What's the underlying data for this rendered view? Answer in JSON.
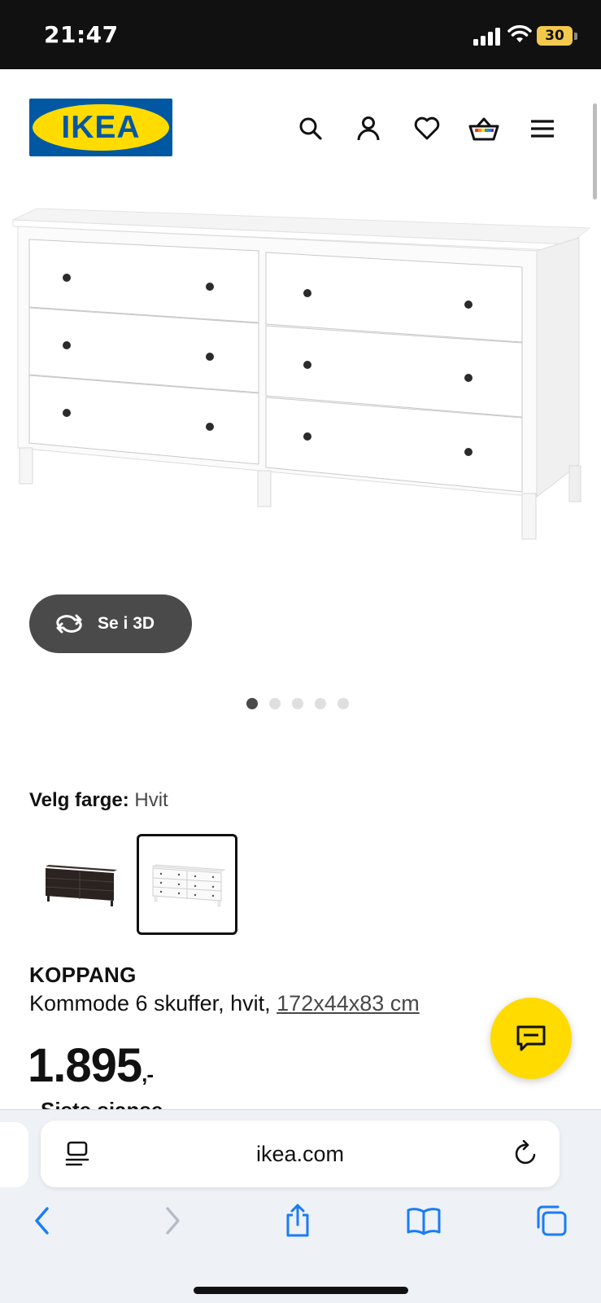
{
  "status_bar": {
    "time": "21:47",
    "battery": "30"
  },
  "header": {
    "logo_text": "IKEA",
    "icons": [
      "search-icon",
      "account-icon",
      "heart-icon",
      "basket-icon",
      "menu-icon"
    ]
  },
  "gallery": {
    "view_3d_label": "Se i 3D",
    "image_count": 5,
    "active_index": 0
  },
  "color_selector": {
    "label": "Velg farge:",
    "selected_value": "Hvit",
    "options": [
      "black-brown",
      "white"
    ],
    "selected_index": 1
  },
  "product": {
    "name": "KOPPANG",
    "description": "Kommode 6 skuffer, hvit, ",
    "dimensions": "172x44x83 cm",
    "price": "1.895",
    "price_suffix": ",-",
    "partial_text": "Siste sjanse"
  },
  "browser": {
    "url": "ikea.com"
  },
  "colors": {
    "ikea_blue": "#0058a3",
    "ikea_yellow": "#ffdb00",
    "dark_button": "#4a4a4a",
    "safari_accent": "#1a7cf5"
  }
}
